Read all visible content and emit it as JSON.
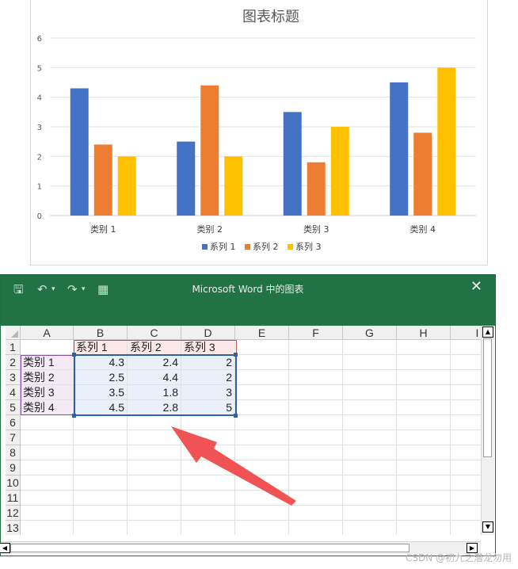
{
  "chart_data": {
    "type": "bar",
    "title": "图表标题",
    "categories": [
      "类别 1",
      "类别 2",
      "类别 3",
      "类别 4"
    ],
    "series": [
      {
        "name": "系列 1",
        "color": "#4472c4",
        "values": [
          4.3,
          2.5,
          3.5,
          4.5
        ]
      },
      {
        "name": "系列 2",
        "color": "#ed7d31",
        "values": [
          2.4,
          4.4,
          1.8,
          2.8
        ]
      },
      {
        "name": "系列 3",
        "color": "#ffc000",
        "values": [
          2,
          2,
          3,
          5
        ]
      }
    ],
    "ylim": [
      0,
      6
    ],
    "yticks": [
      "0",
      "1",
      "2",
      "3",
      "4",
      "5",
      "6"
    ],
    "grid": true,
    "legend": "bottom"
  },
  "window": {
    "title": "Microsoft Word 中的图表",
    "icons": {
      "save": "save-icon",
      "undo": "undo-icon",
      "redo": "redo-icon",
      "edit_data": "edit-data-in-excel-icon",
      "close": "close-icon"
    }
  },
  "sheet": {
    "columns": [
      "A",
      "B",
      "C",
      "D",
      "E",
      "F",
      "G",
      "H",
      "I"
    ],
    "rows": [
      "1",
      "2",
      "3",
      "4",
      "5",
      "6",
      "7",
      "8",
      "9",
      "10",
      "11",
      "12",
      "13"
    ],
    "header_row": [
      "",
      "系列 1",
      "系列 2",
      "系列 3"
    ],
    "data_rows": [
      [
        "类别 1",
        "4.3",
        "2.4",
        "2"
      ],
      [
        "类别 2",
        "2.5",
        "4.4",
        "2"
      ],
      [
        "类别 3",
        "3.5",
        "1.8",
        "3"
      ],
      [
        "类别 4",
        "4.5",
        "2.8",
        "5"
      ]
    ]
  },
  "watermark": "CSDN @初九之潜龙勿用"
}
